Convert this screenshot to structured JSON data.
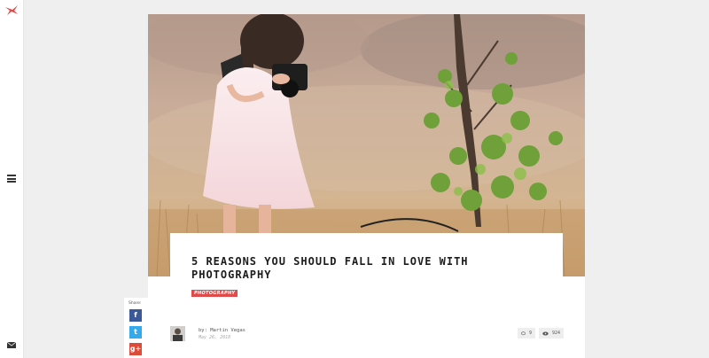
{
  "post": {
    "title": "5 REASONS YOU SHOULD FALL IN LOVE WITH PHOTOGRAPHY",
    "category": "PHOTOGRAPHY",
    "author": "by: Martin Vegas",
    "date": "May 26, 2018",
    "comments": "9",
    "views": "924"
  },
  "share": {
    "label": "Share:",
    "facebook": "f",
    "twitter": "t",
    "googleplus": "g+"
  },
  "colors": {
    "accent": "#e04a4a",
    "facebook": "#3b5998",
    "twitter": "#33aaee",
    "googleplus": "#dd4b39"
  },
  "icons": {
    "logo": "bird-logo-icon",
    "menu": "hamburger-menu-icon",
    "mail": "mail-icon",
    "comments": "comment-icon",
    "views": "eye-icon"
  }
}
